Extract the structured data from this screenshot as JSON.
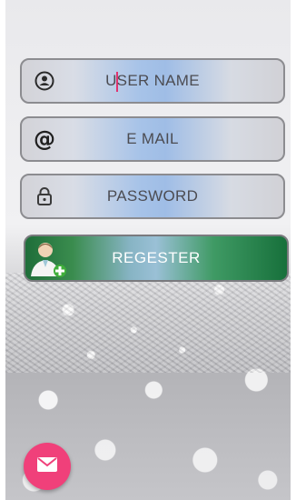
{
  "form": {
    "username": {
      "placeholder": "USER NAME",
      "icon": "user-circle-icon"
    },
    "email": {
      "placeholder": "E MAIL",
      "icon": "at-sign-icon"
    },
    "password": {
      "placeholder": "PASSWORD",
      "icon": "lock-icon"
    }
  },
  "register_button": {
    "label": "REGESTER",
    "icon": "add-user-icon"
  },
  "fab": {
    "icon": "mail-icon"
  },
  "colors": {
    "field_accent": "#9fbde6",
    "register_green": "#1f6e3a",
    "fab_pink": "#f0407a",
    "caret": "#e0336f"
  }
}
